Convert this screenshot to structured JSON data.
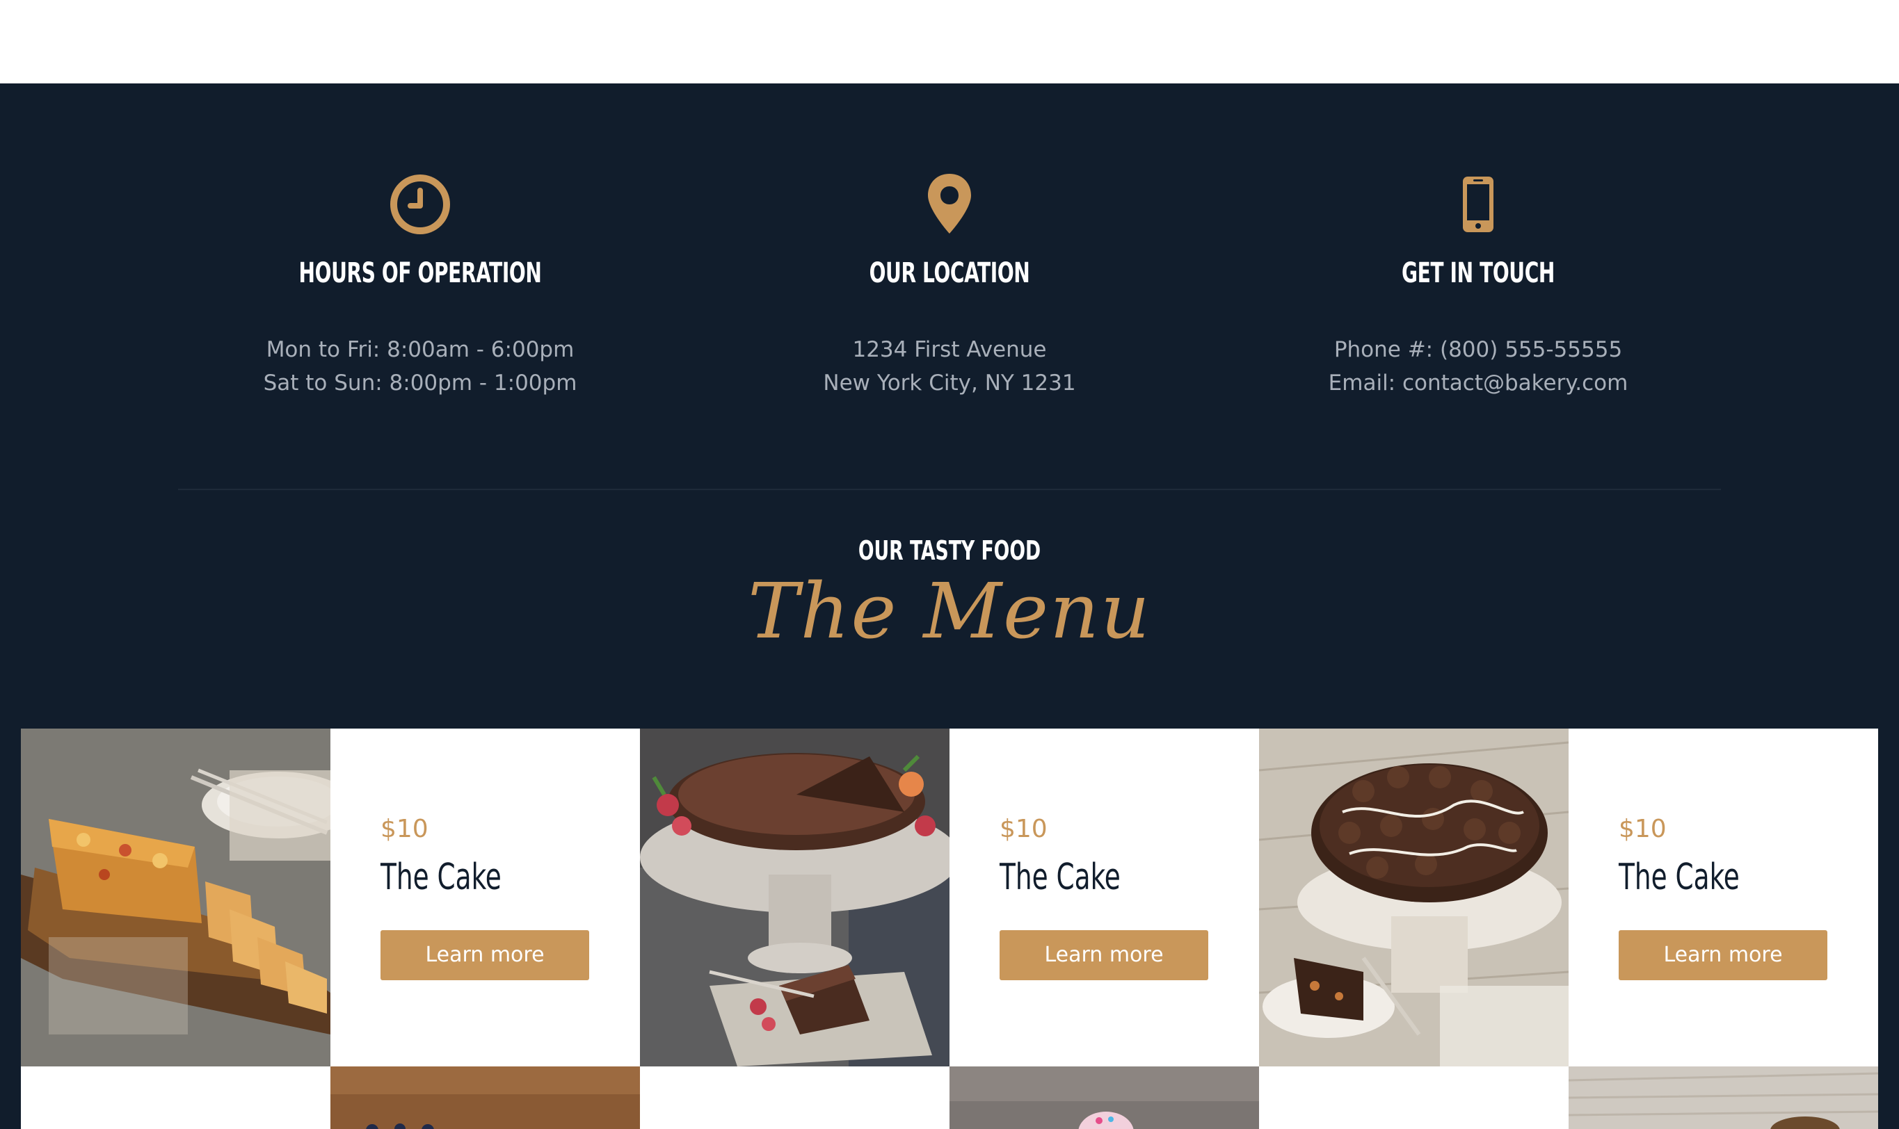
{
  "colors": {
    "background": "#111d2c",
    "accent": "#c9975a",
    "muted_text": "#a9b0ba"
  },
  "info": [
    {
      "icon": "clock-icon",
      "title": "HOURS OF OPERATION",
      "line1": "Mon to Fri: 8:00am - 6:00pm",
      "line2": "Sat to Sun: 8:00pm - 1:00pm"
    },
    {
      "icon": "map-pin-icon",
      "title": "OUR LOCATION",
      "line1": "1234 First Avenue",
      "line2": "New York City, NY 1231"
    },
    {
      "icon": "smartphone-icon",
      "title": "GET IN TOUCH",
      "line1": "Phone #: (800) 555-55555",
      "line2": "Email: contact@bakery.com"
    }
  ],
  "menu": {
    "subtitle": "OUR TASTY FOOD",
    "title": "The Menu",
    "items": [
      {
        "image": "fruit-loaf-photo",
        "price": "$10",
        "name": "The Cake",
        "button": "Learn more"
      },
      {
        "image": "chocolate-cake-photo",
        "price": "$10",
        "name": "The Cake",
        "button": "Learn more"
      },
      {
        "image": "chocolate-truffle-cake-photo",
        "price": "$10",
        "name": "The Cake",
        "button": "Learn more"
      }
    ]
  }
}
